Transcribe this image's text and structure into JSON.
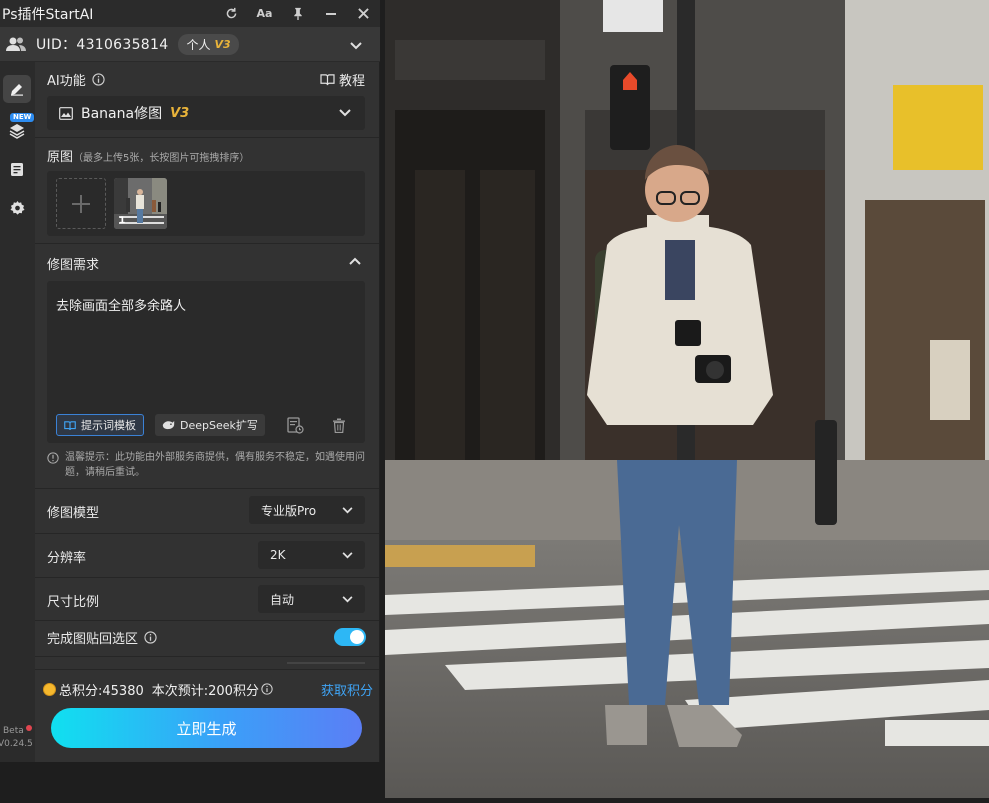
{
  "titlebar": {
    "title": "Ps插件StartAI",
    "buttons": [
      "refresh-icon",
      "font-size-icon",
      "pin-icon",
      "minimize-icon",
      "close-icon"
    ],
    "font_btn_label": "Aa"
  },
  "user": {
    "uid_label": "UID：4310635814",
    "account_type": "个人",
    "version_badge": "V3"
  },
  "sidebar": {
    "items": [
      "edit-icon",
      "layers-icon",
      "notes-icon",
      "settings-icon"
    ],
    "new_tag": "NEW",
    "beta": "Beta",
    "version": "V0.24.5"
  },
  "ai_section": {
    "label": "AI功能",
    "tutorial_label": "教程",
    "feature_value": "Banana修图",
    "feature_version": "V3"
  },
  "source": {
    "label": "原图",
    "hint": "（最多上传5张，长按图片可拖拽排序）",
    "thumb_index": "1"
  },
  "prompt": {
    "label": "修图需求",
    "text": "去除画面全部多余路人",
    "template_btn": "提示词模板",
    "deepseek_btn": "DeepSeek扩写",
    "notice": "温馨提示：此功能由外部服务商提供，偶有服务不稳定，如遇使用问题，请稍后重试。"
  },
  "options": {
    "model_label": "修图模型",
    "model_value": "专业版Pro",
    "resolution_label": "分辨率",
    "resolution_value": "2K",
    "ratio_label": "尺寸比例",
    "ratio_value": "自动",
    "paste_back_label": "完成图贴回选区",
    "paste_back_on": true
  },
  "footer": {
    "total_points": "总积分:45380",
    "cost_estimate": "本次预计:200积分",
    "get_points": "获取积分",
    "generate_label": "立即生成"
  },
  "colors": {
    "accent_blue": "#3fa4f5",
    "v3_gold": "#e8b33a",
    "toggle_on": "#2db7f5",
    "panel_bg": "#323232"
  }
}
